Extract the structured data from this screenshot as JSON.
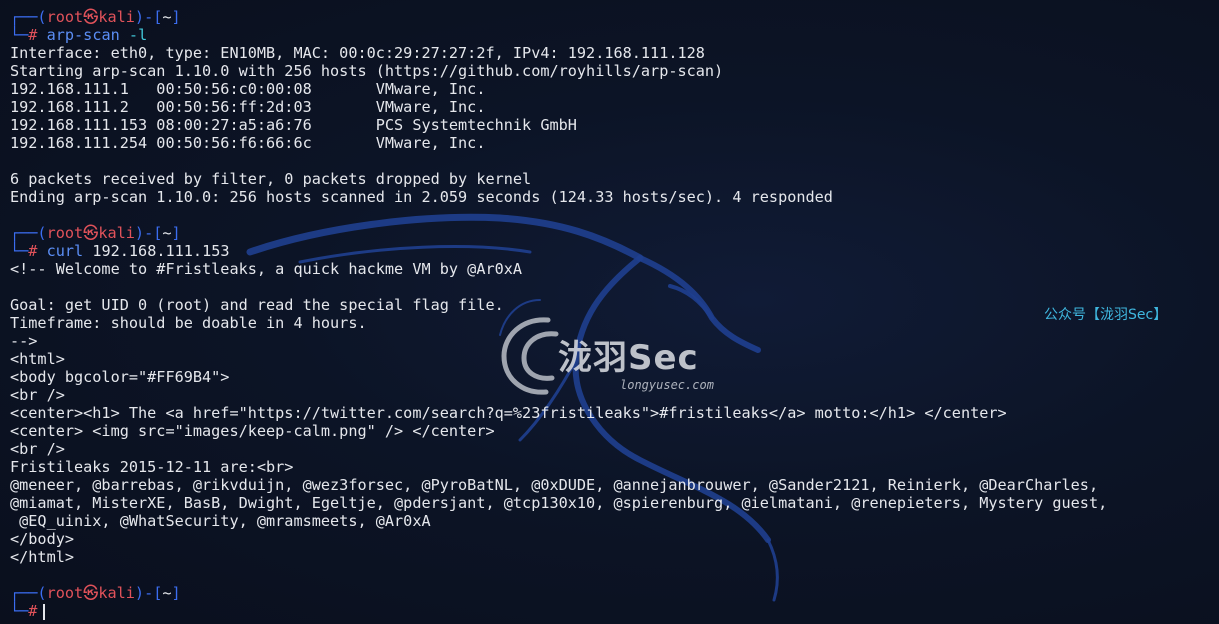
{
  "prompt": {
    "user": "root",
    "sep_glyph": "㉿",
    "host": "kali",
    "dir": "~",
    "symbol": "#"
  },
  "blocks": [
    {
      "command": {
        "name": "arp-scan",
        "args": "-l"
      },
      "output": [
        "Interface: eth0, type: EN10MB, MAC: 00:0c:29:27:27:2f, IPv4: 192.168.111.128",
        "Starting arp-scan 1.10.0 with 256 hosts (https://github.com/royhills/arp-scan)",
        "192.168.111.1   00:50:56:c0:00:08       VMware, Inc.",
        "192.168.111.2   00:50:56:ff:2d:03       VMware, Inc.",
        "192.168.111.153 08:00:27:a5:a6:76       PCS Systemtechnik GmbH",
        "192.168.111.254 00:50:56:f6:66:6c       VMware, Inc.",
        "",
        "6 packets received by filter, 0 packets dropped by kernel",
        "Ending arp-scan 1.10.0: 256 hosts scanned in 2.059 seconds (124.33 hosts/sec). 4 responded"
      ]
    },
    {
      "command": {
        "name": "curl",
        "args": "192.168.111.153"
      },
      "output": [
        "<!-- Welcome to #Fristleaks, a quick hackme VM by @Ar0xA",
        "",
        "Goal: get UID 0 (root) and read the special flag file.",
        "Timeframe: should be doable in 4 hours.",
        "-->",
        "<html>",
        "<body bgcolor=\"#FF69B4\">",
        "<br />",
        "<center><h1> The <a href=\"https://twitter.com/search?q=%23fristileaks\">#fristileaks</a> motto:</h1> </center>",
        "<center> <img src=\"images/keep-calm.png\" /> </center>",
        "<br />",
        "Fristileaks 2015-12-11 are:<br>",
        "@meneer, @barrebas, @rikvduijn, @wez3forsec, @PyroBatNL, @0xDUDE, @annejanbrouwer, @Sander2121, Reinierk, @DearCharles,",
        "@miamat, MisterXE, BasB, Dwight, Egeltje, @pdersjant, @tcp130x10, @spierenburg, @ielmatani, @renepieters, Mystery guest,",
        " @EQ_uinix, @WhatSecurity, @mramsmeets, @Ar0xA",
        "</body>",
        "</html>"
      ]
    }
  ],
  "watermark": {
    "logo_text": "泷羽Sec",
    "logo_url": "longyusec.com",
    "wechat_tag": "公众号【泷羽Sec】"
  },
  "colors": {
    "background": "#0b1120",
    "prompt_frame": "#3b6df0",
    "prompt_user": "#e0525a",
    "command": "#5b8ef5",
    "flag": "#41c7d8",
    "text": "#e5e7ec",
    "wechat_tag": "#3fb7df"
  }
}
